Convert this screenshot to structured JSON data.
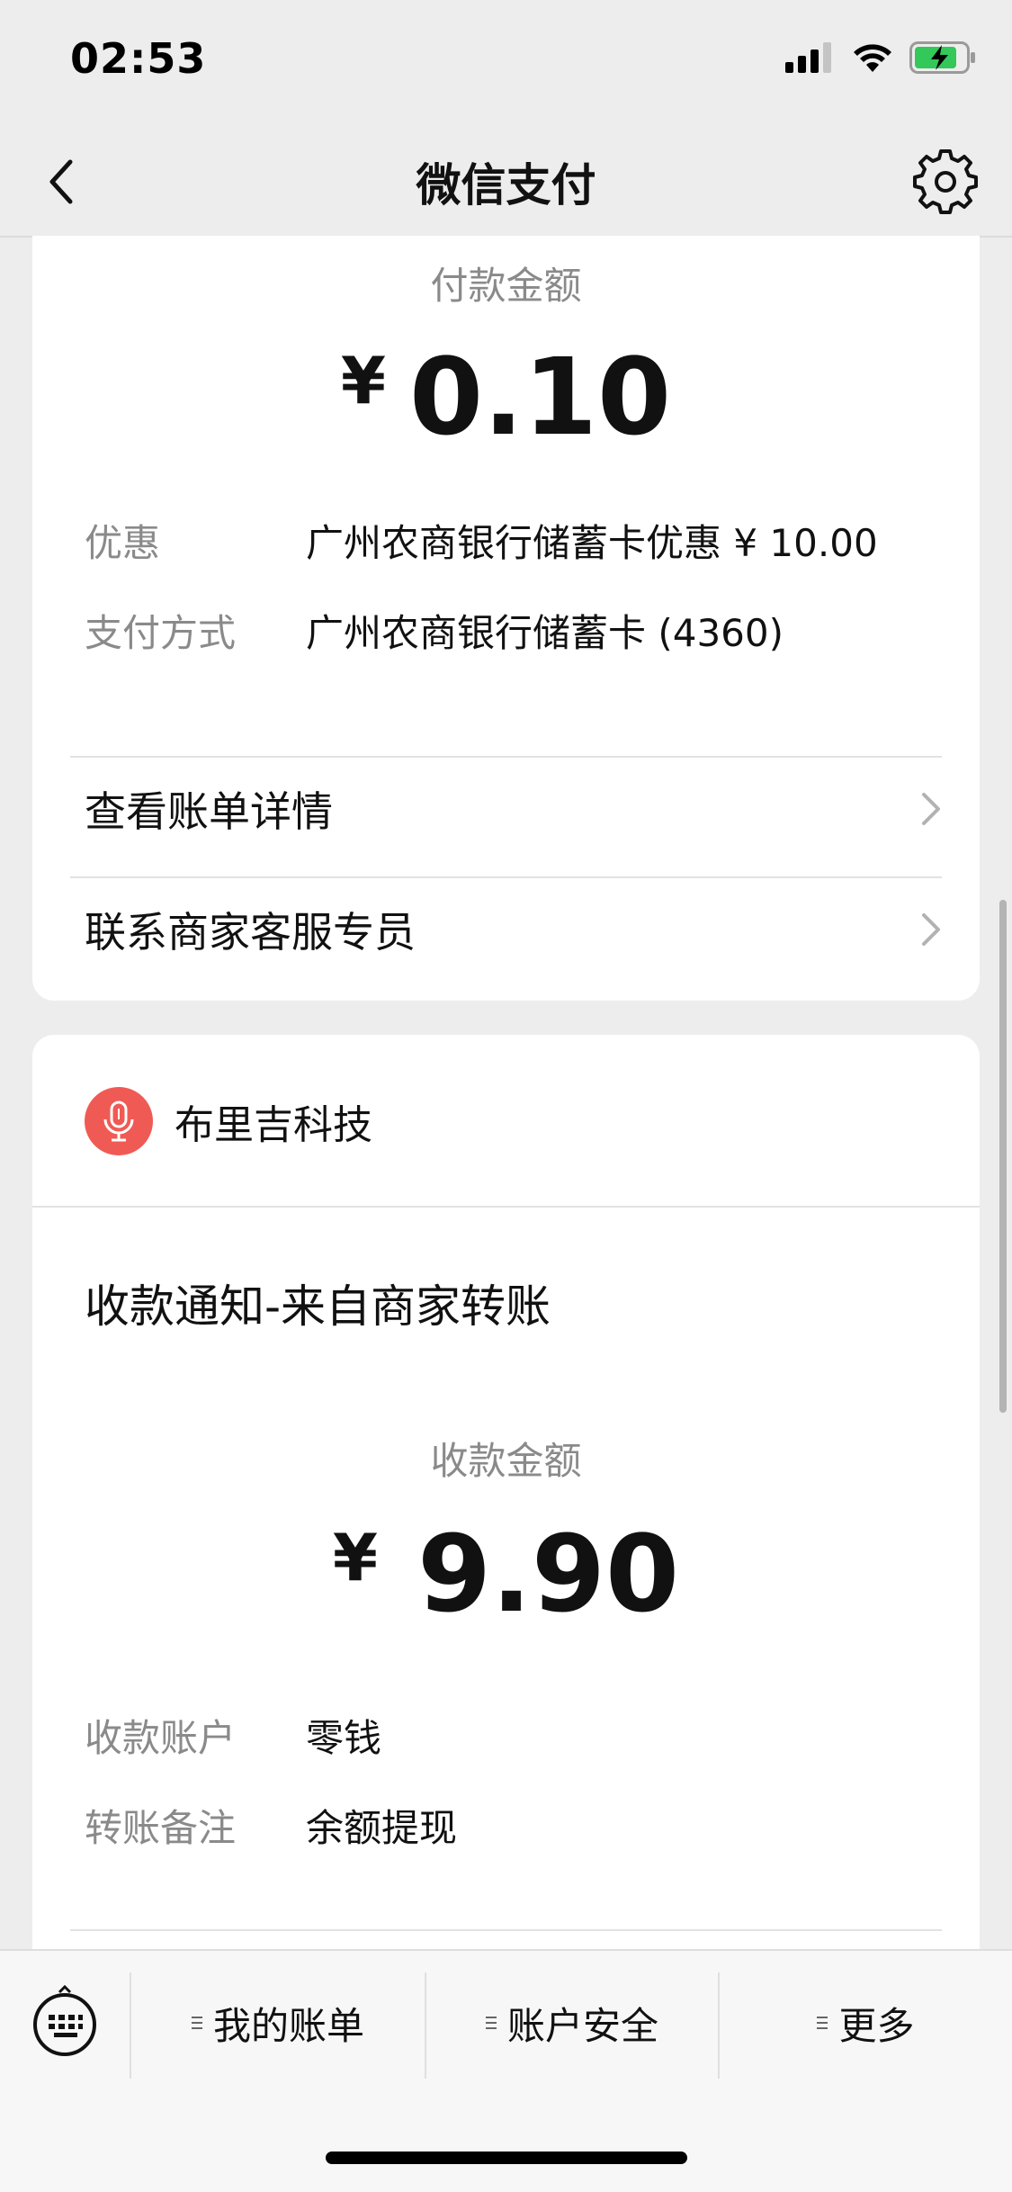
{
  "status_bar": {
    "time": "02:53"
  },
  "nav": {
    "title": "微信支付"
  },
  "payment": {
    "amount_label": "付款金额",
    "currency": "¥",
    "amount": "0.10",
    "rows": [
      {
        "key": "优惠",
        "value": "广州农商银行储蓄卡优惠 ¥ 10.00"
      },
      {
        "key": "支付方式",
        "value": "广州农商银行储蓄卡 (4360)"
      }
    ],
    "links": [
      {
        "label": "查看账单详情"
      },
      {
        "label": "联系商家客服专员"
      }
    ]
  },
  "notice": {
    "merchant_name": "布里吉科技",
    "title": "收款通知-来自商家转账",
    "amount_label": "收款金额",
    "currency": "¥",
    "amount": "9.90",
    "rows": [
      {
        "key": "收款账户",
        "value": "零钱"
      },
      {
        "key": "转账备注",
        "value": "余额提现"
      }
    ]
  },
  "bottom_bar": {
    "items": [
      {
        "label": "我的账单"
      },
      {
        "label": "账户安全"
      },
      {
        "label": "更多"
      }
    ]
  },
  "colors": {
    "background": "#ededed",
    "card": "#ffffff",
    "secondary_text": "#8a8a8a",
    "merchant_avatar": "#f05a54"
  },
  "icons": {
    "back": "chevron-left-icon",
    "settings": "gear-icon",
    "merchant": "microphone-icon",
    "keyboard": "keyboard-icon",
    "link_arrow": "chevron-right-icon"
  }
}
